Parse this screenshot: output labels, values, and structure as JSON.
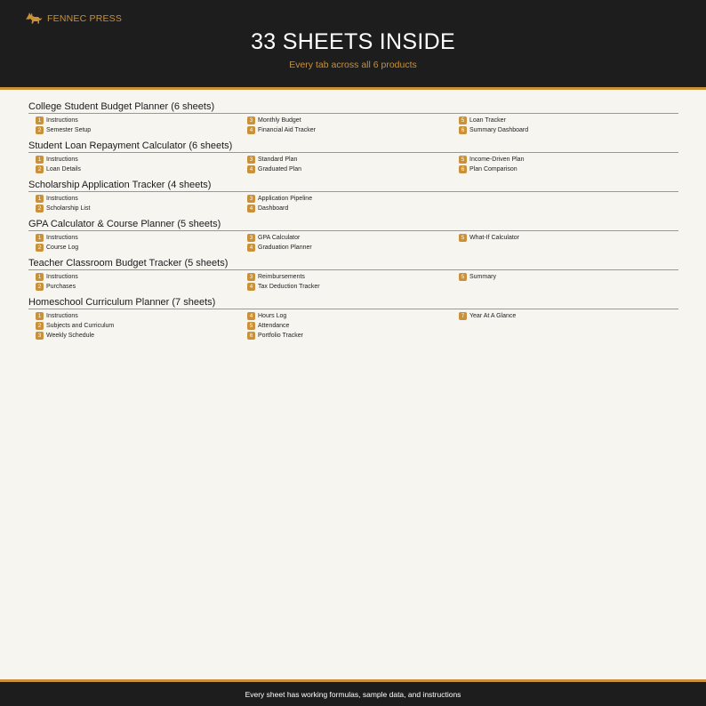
{
  "brand": {
    "name": "FENNEC PRESS",
    "icon": "fox-icon"
  },
  "title": "33 SHEETS INSIDE",
  "subtitle": "Every tab across all 6 products",
  "colors": {
    "accent": "#c8913a",
    "dark": "#1d1d1d",
    "background": "#f7f5f0"
  },
  "products": [
    {
      "title": "College Student Budget Planner (6 sheets)",
      "sheets": [
        {
          "num": "1",
          "name": "Instructions"
        },
        {
          "num": "2",
          "name": "Semester Setup"
        },
        {
          "num": "3",
          "name": "Monthly Budget"
        },
        {
          "num": "4",
          "name": "Financial Aid Tracker"
        },
        {
          "num": "5",
          "name": "Loan Tracker"
        },
        {
          "num": "6",
          "name": "Summary Dashboard"
        }
      ]
    },
    {
      "title": "Student Loan Repayment Calculator (6 sheets)",
      "sheets": [
        {
          "num": "1",
          "name": "Instructions"
        },
        {
          "num": "2",
          "name": "Loan Details"
        },
        {
          "num": "3",
          "name": "Standard Plan"
        },
        {
          "num": "4",
          "name": "Graduated Plan"
        },
        {
          "num": "5",
          "name": "Income-Driven Plan"
        },
        {
          "num": "6",
          "name": "Plan Comparison"
        }
      ]
    },
    {
      "title": "Scholarship Application Tracker (4 sheets)",
      "sheets": [
        {
          "num": "1",
          "name": "Instructions"
        },
        {
          "num": "2",
          "name": "Scholarship List"
        },
        {
          "num": "3",
          "name": "Application Pipeline"
        },
        {
          "num": "4",
          "name": "Dashboard"
        }
      ]
    },
    {
      "title": "GPA Calculator & Course Planner (5 sheets)",
      "sheets": [
        {
          "num": "1",
          "name": "Instructions"
        },
        {
          "num": "2",
          "name": "Course Log"
        },
        {
          "num": "3",
          "name": "GPA Calculator"
        },
        {
          "num": "4",
          "name": "Graduation Planner"
        },
        {
          "num": "5",
          "name": "What-If Calculator"
        }
      ]
    },
    {
      "title": "Teacher Classroom Budget Tracker (5 sheets)",
      "sheets": [
        {
          "num": "1",
          "name": "Instructions"
        },
        {
          "num": "2",
          "name": "Purchases"
        },
        {
          "num": "3",
          "name": "Reimbursements"
        },
        {
          "num": "4",
          "name": "Tax Deduction Tracker"
        },
        {
          "num": "5",
          "name": "Summary"
        }
      ]
    },
    {
      "title": "Homeschool Curriculum Planner (7 sheets)",
      "sheets": [
        {
          "num": "1",
          "name": "Instructions"
        },
        {
          "num": "2",
          "name": "Subjects and Curriculum"
        },
        {
          "num": "3",
          "name": "Weekly Schedule"
        },
        {
          "num": "4",
          "name": "Hours Log"
        },
        {
          "num": "5",
          "name": "Attendance"
        },
        {
          "num": "6",
          "name": "Portfolio Tracker"
        },
        {
          "num": "7",
          "name": "Year At A Glance"
        }
      ]
    }
  ],
  "footer": "Every sheet has working formulas, sample data, and instructions"
}
